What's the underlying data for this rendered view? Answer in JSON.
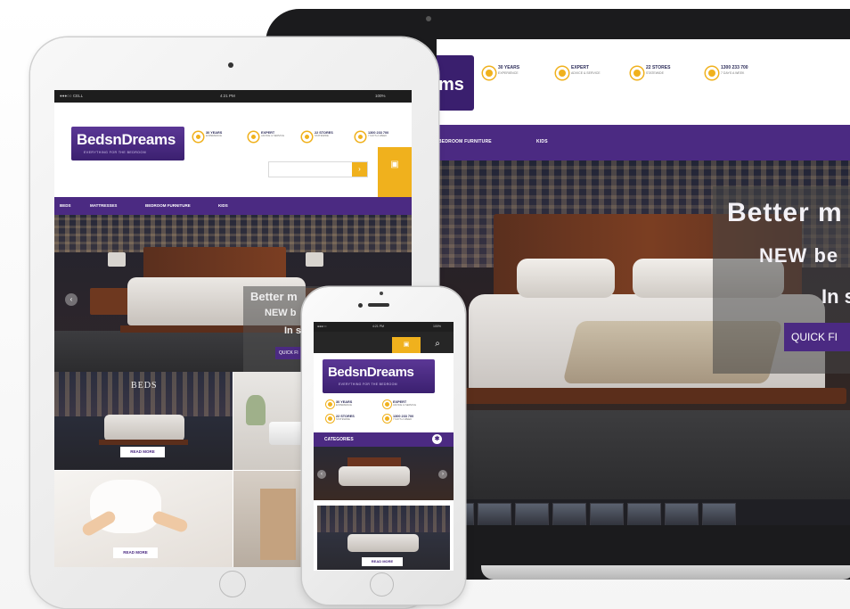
{
  "brand": {
    "name": "BedsnDreams",
    "name_laptop_fragment": "ms",
    "tagline": "EVERYTHING FOR THE BEDROOM",
    "purple": "#4b2a82",
    "gold": "#f0b11d"
  },
  "badges": [
    {
      "title": "30 YEARS",
      "sub": "EXPERIENCE"
    },
    {
      "title": "EXPERT",
      "sub": "ADVICE & SERVICE"
    },
    {
      "title": "22 STORES",
      "sub": "STATEWIDE"
    },
    {
      "title": "1300 233 700",
      "sub": "7 DAYS A WEEK"
    }
  ],
  "laptop": {
    "nav": [
      "BEDROOM FURNITURE",
      "KIDS"
    ],
    "hero": {
      "line1": "Better m",
      "line2": "NEW be",
      "line3": "In s",
      "button": "QUICK FI"
    }
  },
  "tablet": {
    "status": {
      "carrier": "●●●○○ CELL",
      "time": "4:21 PM",
      "battery": "100%"
    },
    "nav": [
      "BEDS",
      "MATTRESSES",
      "BEDROOM FURNITURE",
      "KIDS"
    ],
    "hero": {
      "line1": "Better m",
      "line2": "NEW b",
      "line3": "In s",
      "button": "QUICK FI"
    },
    "tiles": [
      {
        "title": "BEDS",
        "button": "READ MORE"
      },
      {
        "title": "",
        "button": "READ MORE"
      }
    ]
  },
  "phone": {
    "status": {
      "carrier": "●●●○○",
      "time": "4:21 PM",
      "battery": "100%"
    },
    "categories_label": "CATEGORIES",
    "tile_button": "READ MORE"
  }
}
